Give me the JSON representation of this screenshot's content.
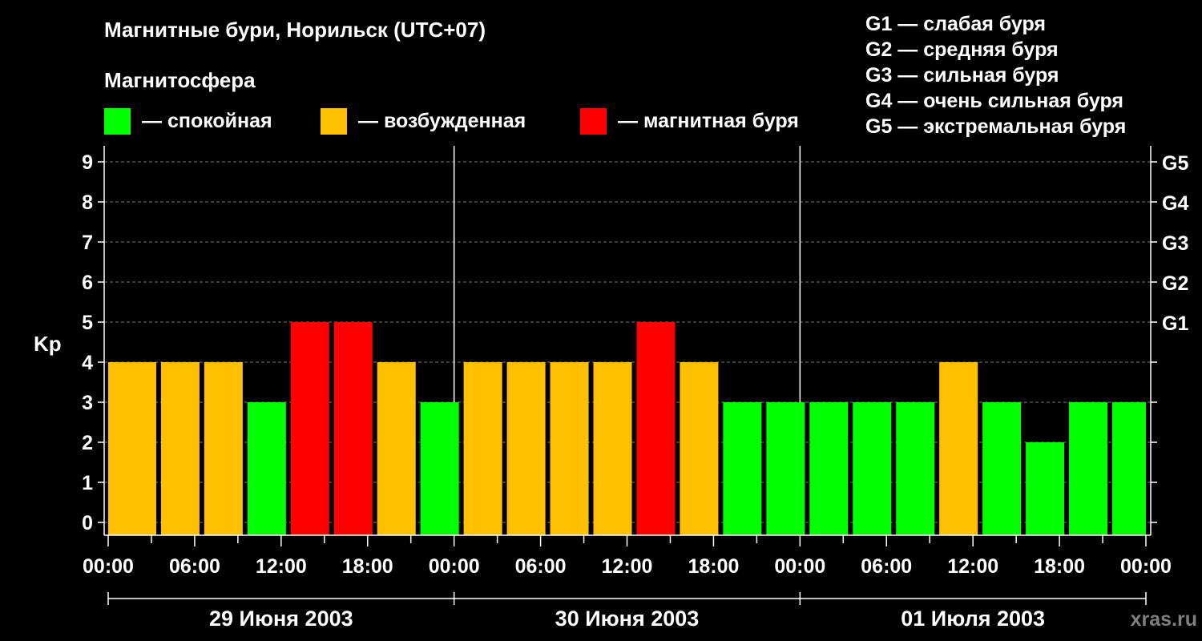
{
  "header": {
    "title": "Магнитные бури, Норильск (UTC+07)",
    "subtitle": "Магнитосфера"
  },
  "legend": {
    "items": [
      {
        "label": "— спокойная",
        "color": "#00ff00"
      },
      {
        "label": "— возбужденная",
        "color": "#ffc000"
      },
      {
        "label": "— магнитная буря",
        "color": "#ff0000"
      }
    ]
  },
  "g_legend": [
    "G1 — слабая буря",
    "G2 — средняя буря",
    "G3 — сильная буря",
    "G4 — очень сильная буря",
    "G5 — экстремальная буря"
  ],
  "watermark": "xras.ru",
  "colors": {
    "quiet": "#00ff00",
    "excited": "#ffc000",
    "storm": "#ff0000",
    "background": "#000000",
    "axis": "#ffffff"
  },
  "chart_data": {
    "type": "bar",
    "ylabel": "Kp",
    "ylim": [
      0,
      9
    ],
    "yticks": [
      "0",
      "1",
      "2",
      "3",
      "4",
      "5",
      "6",
      "7",
      "8",
      "9"
    ],
    "right_ticks": [
      {
        "value": 5,
        "label": "G1"
      },
      {
        "value": 6,
        "label": "G2"
      },
      {
        "value": 7,
        "label": "G3"
      },
      {
        "value": 8,
        "label": "G4"
      },
      {
        "value": 9,
        "label": "G5"
      }
    ],
    "grid": true,
    "xlim_hours": [
      0,
      72
    ],
    "xtick_labels": [
      "00:00",
      "06:00",
      "12:00",
      "18:00",
      "00:00",
      "06:00",
      "12:00",
      "18:00",
      "00:00",
      "06:00",
      "12:00",
      "18:00",
      "00:00"
    ],
    "days": [
      "29 Июня 2003",
      "30 Июня 2003",
      "01 Июля 2003"
    ],
    "bar_times": [
      "00:00",
      "02:00",
      "05:00",
      "08:00",
      "11:00",
      "14:00",
      "17:00",
      "20:00",
      "23:00",
      "02:00",
      "05:00",
      "08:00",
      "11:00",
      "14:00",
      "17:00",
      "20:00",
      "23:00",
      "02:00",
      "05:00",
      "08:00",
      "11:00",
      "14:00",
      "17:00",
      "20:00",
      "23:00"
    ],
    "values": [
      4,
      4,
      4,
      4,
      3,
      5,
      5,
      4,
      3,
      4,
      4,
      4,
      4,
      5,
      4,
      3,
      3,
      3,
      3,
      3,
      4,
      3,
      2,
      3,
      3
    ],
    "levels": [
      "excited",
      "excited",
      "excited",
      "excited",
      "quiet",
      "storm",
      "storm",
      "excited",
      "quiet",
      "excited",
      "excited",
      "excited",
      "excited",
      "storm",
      "excited",
      "quiet",
      "quiet",
      "quiet",
      "quiet",
      "quiet",
      "excited",
      "quiet",
      "quiet",
      "quiet",
      "quiet"
    ]
  }
}
